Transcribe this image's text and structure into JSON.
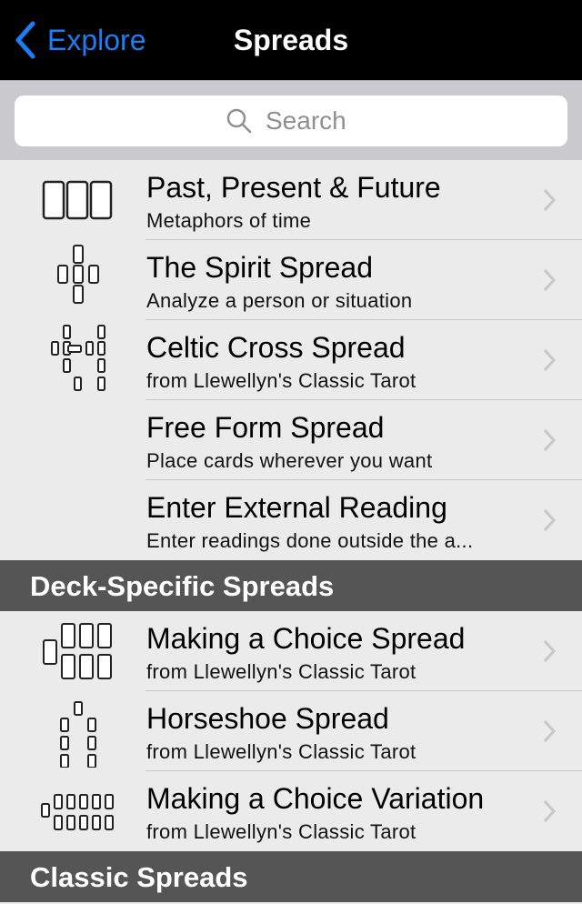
{
  "navbar": {
    "back_label": "Explore",
    "title": "Spreads",
    "accent_color": "#1a7ff5"
  },
  "search": {
    "placeholder": "Search",
    "value": ""
  },
  "sections": [
    {
      "header": "",
      "items": [
        {
          "title": "Past, Present & Future",
          "subtitle": "Metaphors of time",
          "icon": "three-card-spread-icon"
        },
        {
          "title": "The Spirit Spread",
          "subtitle": "Analyze a person or situation",
          "icon": "cross-five-card-spread-icon"
        },
        {
          "title": "Celtic Cross Spread",
          "subtitle": "from Llewellyn's Classic Tarot",
          "icon": "celtic-cross-spread-icon"
        },
        {
          "title": "Free Form Spread",
          "subtitle": "Place cards wherever you want",
          "icon": ""
        },
        {
          "title": "Enter External Reading",
          "subtitle": "Enter readings done outside the a...",
          "icon": ""
        }
      ]
    },
    {
      "header": "Deck-Specific Spreads",
      "items": [
        {
          "title": "Making a Choice Spread",
          "subtitle": "from Llewellyn's Classic Tarot",
          "icon": "making-choice-spread-icon"
        },
        {
          "title": "Horseshoe Spread",
          "subtitle": "from Llewellyn's Classic Tarot",
          "icon": "horseshoe-spread-icon"
        },
        {
          "title": "Making a Choice Variation",
          "subtitle": "from Llewellyn's Classic Tarot",
          "icon": "making-choice-variation-icon"
        }
      ]
    },
    {
      "header": "Classic Spreads",
      "items": []
    }
  ]
}
